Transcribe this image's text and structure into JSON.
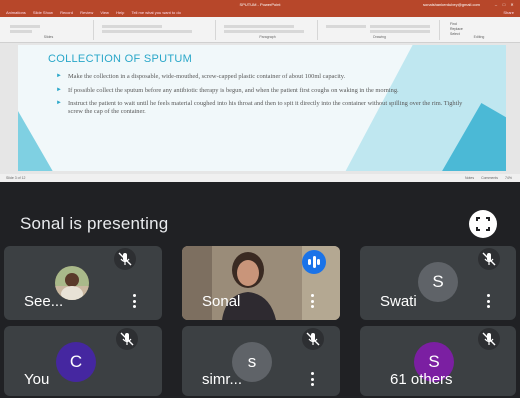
{
  "shared_screen": {
    "window_title": "SPUTUM - PowerPoint",
    "account": "sonalshankerdubey@gmail.com",
    "menu_items": [
      "Animations",
      "Slide Show",
      "Record",
      "Review",
      "View",
      "Help",
      "Tell me what you want to do"
    ],
    "share_label": "Share",
    "ribbon_groups": [
      "Slides",
      "Paragraph",
      "Drawing",
      "Editing"
    ],
    "ribbon_extra": [
      "Find",
      "Replace",
      "Select"
    ],
    "slide": {
      "title": "COLLECTION OF SPUTUM",
      "bullets": [
        "Make the collection in a disposable, wide-mouthed, screw-capped plastic container of about 100ml capacity.",
        "If possible collect the sputum before any antibiotic therapy is begun, and when the patient first coughs on waking in the morning.",
        "Instruct the patient to wait until he feels material coughed into his throat and then to spit it directly into the container without spilling over the rim. Tightly screw the cap of the container."
      ]
    },
    "status": {
      "slide_info": "Slide 3 of 12",
      "notes": "Notes",
      "comments": "Comments",
      "zoom": "74%"
    }
  },
  "presenting_label": "Sonal is presenting",
  "colors": {
    "background": "#202124",
    "tile": "#3c4043",
    "speaking": "#1a73e8",
    "avatar_swati": "#5f6368",
    "avatar_you": "#4527a0",
    "avatar_simr": "#5f6368",
    "avatar_others": "#7b1fa2"
  },
  "participants": [
    {
      "name": "See...",
      "avatar": "photo",
      "muted": true
    },
    {
      "name": "Sonal",
      "avatar": "video",
      "muted": false,
      "speaking": true
    },
    {
      "name": "Swati",
      "avatar_letter": "S",
      "muted": true
    },
    {
      "name": "You",
      "avatar_letter": "C",
      "muted": true
    },
    {
      "name": "simr...",
      "avatar_letter": "s",
      "muted": true
    },
    {
      "name": "61 others",
      "avatar_letter": "S",
      "muted": true
    }
  ],
  "icons": {
    "mute": "mic-off-icon",
    "more": "more-vert-icon",
    "fullscreen": "fullscreen-icon",
    "speaking": "audio-level-icon"
  }
}
